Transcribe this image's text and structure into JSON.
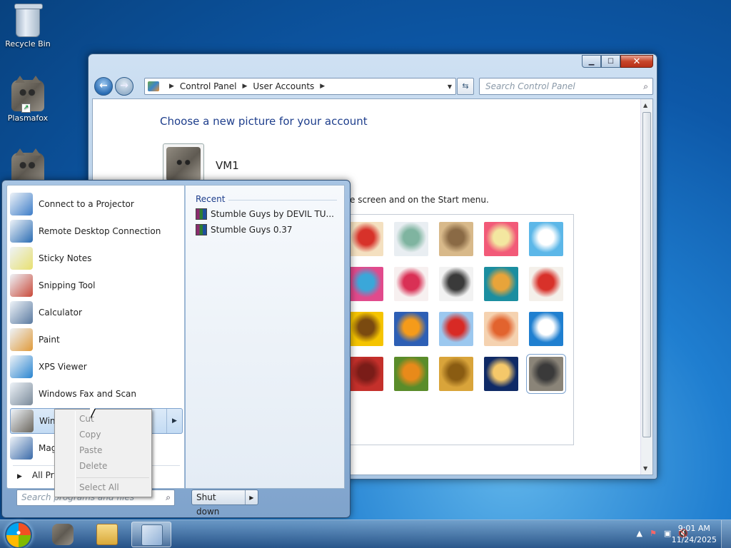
{
  "desktop": {
    "icons": [
      {
        "label": "Recycle Bin",
        "icon": "recycle-bin-icon"
      },
      {
        "label": "Plasmafox",
        "icon": "cat-icon"
      }
    ]
  },
  "window": {
    "breadcrumb": [
      "Control Panel",
      "User Accounts"
    ],
    "search_placeholder": "Search Control Panel",
    "page_title": "Choose a new picture for your account",
    "account_name": "VM1",
    "description_partial": "e screen and on the Start menu.",
    "pictures": [
      {
        "name": "lucky-cat",
        "colors": [
          "#f4e0c0",
          "#d7322a"
        ]
      },
      {
        "name": "glass-ring",
        "colors": [
          "#e9eef2",
          "#7fb4a0"
        ]
      },
      {
        "name": "sleeping-kitten",
        "colors": [
          "#d8b98a",
          "#8a6a45"
        ]
      },
      {
        "name": "red-flower",
        "colors": [
          "#f25a78",
          "#f3e7a0"
        ]
      },
      {
        "name": "pinwheel",
        "colors": [
          "#5cb7e8",
          "#ffffff"
        ]
      },
      {
        "name": "crayons",
        "colors": [
          "#e14a8c",
          "#3aa7d9"
        ]
      },
      {
        "name": "star-lantern",
        "colors": [
          "#f7f0f0",
          "#d93055"
        ]
      },
      {
        "name": "jacks",
        "colors": [
          "#f2f2f2",
          "#3a3a3a"
        ]
      },
      {
        "name": "stairs",
        "colors": [
          "#1b8ea0",
          "#e8a43a"
        ]
      },
      {
        "name": "origami-crane",
        "colors": [
          "#f4f0ea",
          "#d8312a"
        ]
      },
      {
        "name": "sunflower",
        "colors": [
          "#f5c400",
          "#7a4a10"
        ]
      },
      {
        "name": "fish",
        "colors": [
          "#2d5fb5",
          "#f59b1a"
        ]
      },
      {
        "name": "hot-air-balloon",
        "colors": [
          "#9cc8ef",
          "#d82a25"
        ]
      },
      {
        "name": "daruma",
        "colors": [
          "#f5d2b0",
          "#e2632e"
        ]
      },
      {
        "name": "sailboat",
        "colors": [
          "#1f7fd0",
          "#ffffff"
        ]
      },
      {
        "name": "fabric",
        "colors": [
          "#c4302b",
          "#7a1c18"
        ]
      },
      {
        "name": "butterfly",
        "colors": [
          "#5a8c2a",
          "#e88a1a"
        ]
      },
      {
        "name": "basket",
        "colors": [
          "#d9a43a",
          "#8a5c12"
        ]
      },
      {
        "name": "lighthouse",
        "colors": [
          "#0f2a66",
          "#f5c86a"
        ]
      },
      {
        "name": "cat",
        "colors": [
          "#8a8478",
          "#3a3a3a"
        ]
      }
    ]
  },
  "start_menu": {
    "items": [
      {
        "label": "Connect to a Projector",
        "icon": "projector-icon",
        "color": "#3d7dc8"
      },
      {
        "label": "Remote Desktop Connection",
        "icon": "remote-desktop-icon",
        "color": "#2a6cb3"
      },
      {
        "label": "Sticky Notes",
        "icon": "sticky-notes-icon",
        "color": "#e8e070"
      },
      {
        "label": "Snipping Tool",
        "icon": "snipping-tool-icon",
        "color": "#c94a3a"
      },
      {
        "label": "Calculator",
        "icon": "calculator-icon",
        "color": "#5a7aa0"
      },
      {
        "label": "Paint",
        "icon": "paint-icon",
        "color": "#e09a3a"
      },
      {
        "label": "XPS Viewer",
        "icon": "xps-viewer-icon",
        "color": "#2a85d0"
      },
      {
        "label": "Windows Fax and Scan",
        "icon": "fax-icon",
        "color": "#7a8a9a"
      },
      {
        "label": "WinR",
        "icon": "cat-icon",
        "color": "#6a655c"
      },
      {
        "label": "Mag",
        "icon": "magnifier-icon",
        "color": "#3a6aa8"
      }
    ],
    "all_programs": "All Pr",
    "recent_header": "Recent",
    "recent_items": [
      "Stumble Guys  by DEVIL TU...",
      "Stumble Guys 0.37"
    ],
    "search_placeholder": "Search programs and files",
    "shutdown_label": "Shut down"
  },
  "context_menu": {
    "items": [
      "Cut",
      "Copy",
      "Paste",
      "Delete",
      "Select All"
    ]
  },
  "taskbar": {
    "time": "9:01 AM",
    "date": "11/24/2025"
  }
}
